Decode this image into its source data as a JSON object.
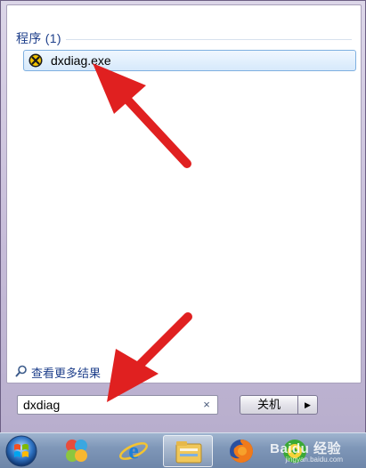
{
  "results": {
    "group_header": "程序 (1)",
    "items": [
      {
        "label": "dxdiag.exe",
        "icon": "directx-icon"
      }
    ]
  },
  "see_more": {
    "label": "查看更多结果",
    "icon": "search-icon"
  },
  "search": {
    "value": "dxdiag",
    "clear_symbol": "×"
  },
  "power": {
    "label": "关机",
    "arrow": "▶"
  },
  "taskbar": {
    "apps": [
      {
        "name": "start-orb"
      },
      {
        "name": "color-app-icon"
      },
      {
        "name": "internet-explorer-icon"
      },
      {
        "name": "file-explorer-icon",
        "active": true
      },
      {
        "name": "firefox-icon"
      },
      {
        "name": "green-app-icon"
      }
    ]
  },
  "watermark": {
    "text": "Baidu 经验",
    "sub": "jingyan.baidu.com"
  },
  "colors": {
    "accent": "#1e3f8b",
    "annotation_arrow": "#e02020",
    "selection": "#d6e9fb"
  }
}
